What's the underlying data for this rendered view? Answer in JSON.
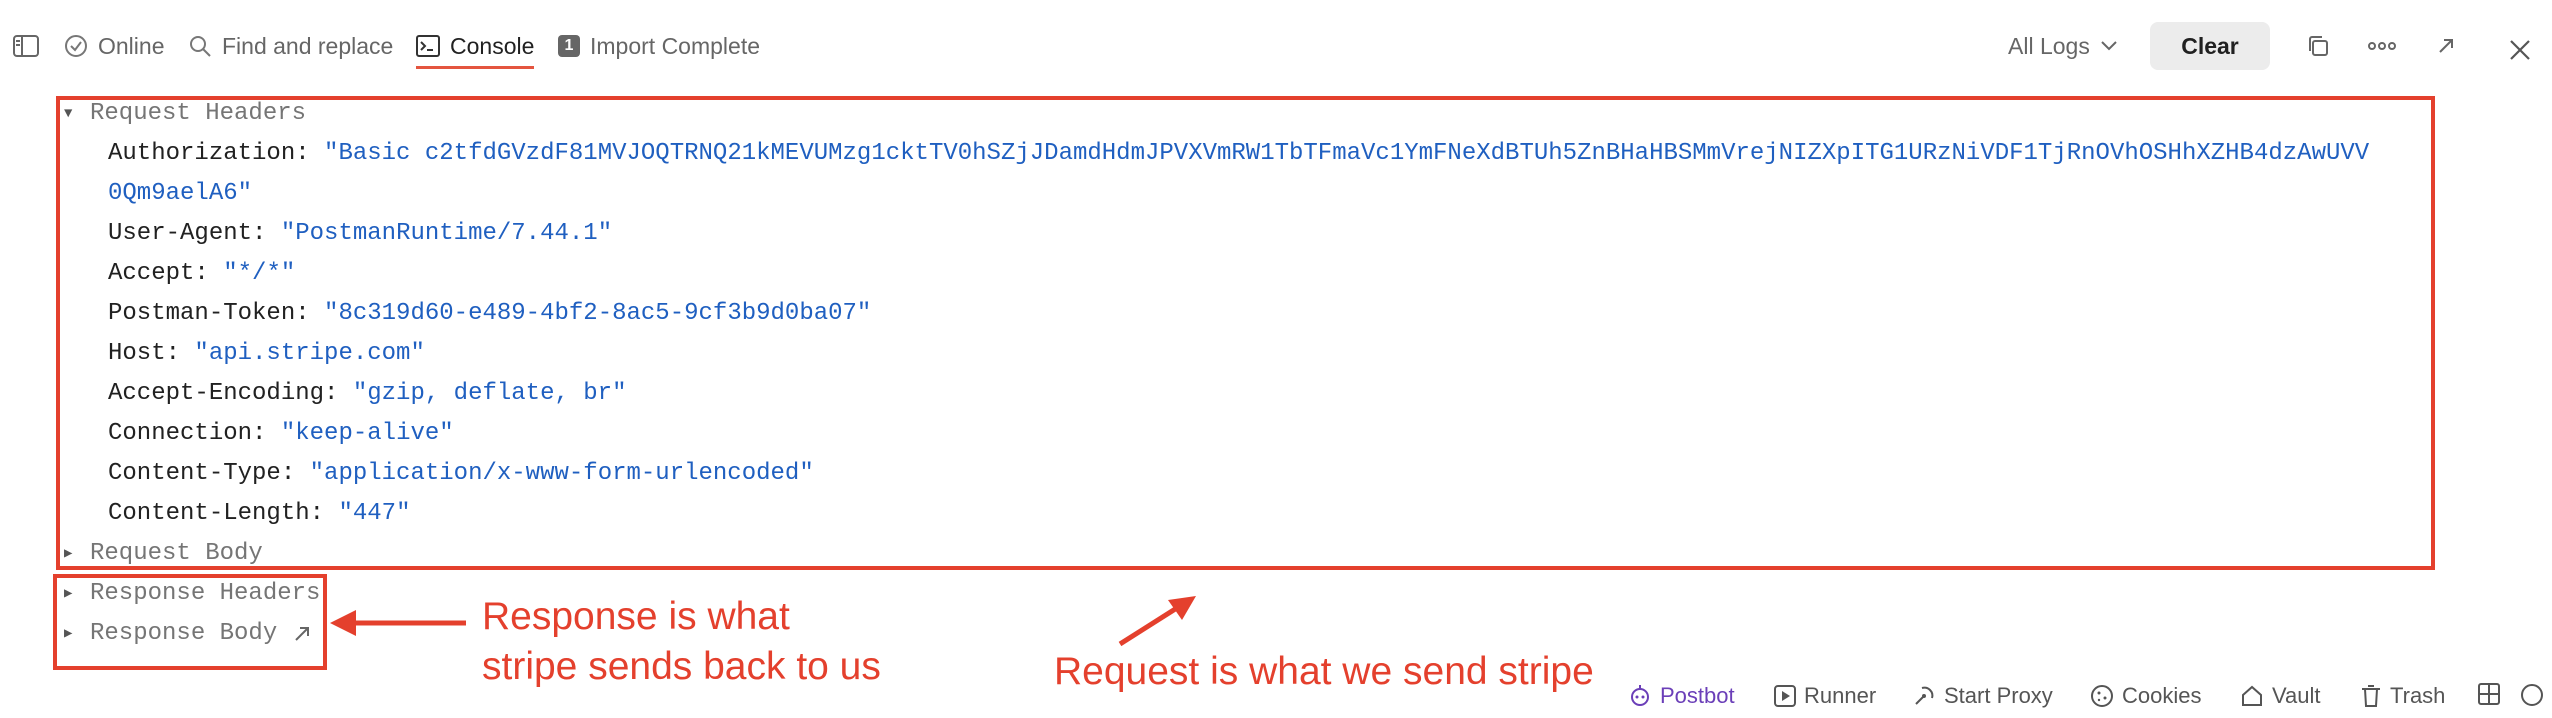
{
  "toolbar": {
    "online_label": "Online",
    "find_replace_label": "Find and replace",
    "console_label": "Console",
    "import_badge": "1",
    "import_label": "Import Complete",
    "logs_filter": "All Logs",
    "clear_label": "Clear"
  },
  "request_headers": {
    "title": "Request Headers",
    "items": [
      {
        "key": "Authorization:",
        "value": "\"Basic c2tfdGVzdF81MVJOQTRNQ21kMEVUMzg1cktTV0hSZjJDamdHdmJPVXVmRW1TbTFmaVc1YmFNeXdBTUh5ZnBHaHBSMmVrejNIZXpITG1URzNiVDF1TjRnOVhOSHhXZHB4dzAwUVV",
        "value_cont": "0Qm9aelA6\""
      },
      {
        "key": "User-Agent:",
        "value": "\"PostmanRuntime/7.44.1\""
      },
      {
        "key": "Accept:",
        "value": "\"*/*\""
      },
      {
        "key": "Postman-Token:",
        "value": "\"8c319d60-e489-4bf2-8ac5-9cf3b9d0ba07\""
      },
      {
        "key": "Host:",
        "value": "\"api.stripe.com\""
      },
      {
        "key": "Accept-Encoding:",
        "value": "\"gzip, deflate, br\""
      },
      {
        "key": "Connection:",
        "value": "\"keep-alive\""
      },
      {
        "key": "Content-Type:",
        "value": "\"application/x-www-form-urlencoded\""
      },
      {
        "key": "Content-Length:",
        "value": "\"447\""
      }
    ]
  },
  "request_body": {
    "title": "Request Body"
  },
  "response_headers": {
    "title": "Response Headers"
  },
  "response_body": {
    "title": "Response Body"
  },
  "annotations": {
    "response_line1": "Response is what",
    "response_line2": "stripe sends back to us",
    "request_text": "Request is what we send stripe",
    "color": "#e4402d"
  },
  "footer": {
    "postbot": "Postbot",
    "runner": "Runner",
    "start_proxy": "Start Proxy",
    "cookies": "Cookies",
    "vault": "Vault",
    "trash": "Trash"
  }
}
